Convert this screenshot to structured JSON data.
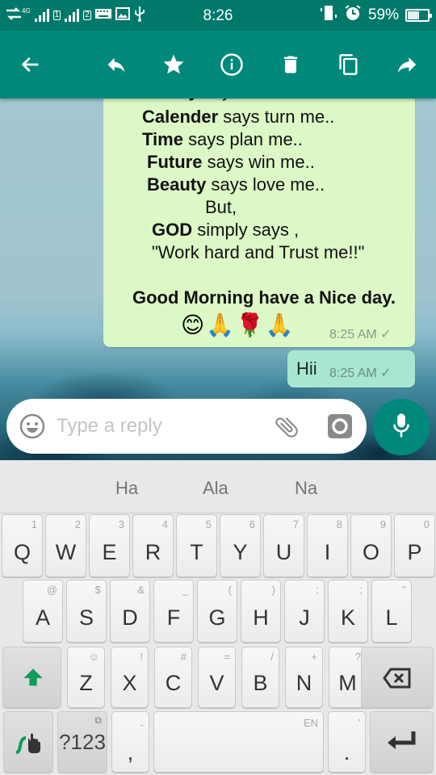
{
  "status_bar": {
    "time": "8:26",
    "network_type": "4G",
    "sim1_label": "1",
    "sim2_label": "2",
    "battery_percent_text": "59%",
    "battery_level": 0.59,
    "icons": [
      "data-transfer-icon",
      "signal-sim1-icon",
      "signal-sim2-icon",
      "keyboard-icon",
      "image-icon",
      "usb-icon",
      "vibrate-icon",
      "alarm-icon",
      "battery-icon"
    ]
  },
  "action_bar": {
    "icons": [
      "back-arrow-icon",
      "reply-icon",
      "star-icon",
      "info-icon",
      "delete-icon",
      "copy-icon",
      "forward-icon"
    ]
  },
  "messages": [
    {
      "type": "outgoing",
      "lines": [
        {
          "bold": "Money",
          "rest": " says earn me.."
        },
        {
          "bold": "Calender",
          "rest": " says turn me.."
        },
        {
          "bold": "Time",
          "rest": " says plan me.."
        },
        {
          "bold": "Future",
          "rest": " says win me.."
        },
        {
          "bold": "Beauty",
          "rest": " says love me.."
        },
        {
          "bold": "",
          "rest": "But,"
        },
        {
          "bold": "GOD",
          "rest": " simply says ,"
        },
        {
          "bold": "",
          "rest": "\"Work hard and Trust me!!\""
        },
        {
          "bold": "Good Morning have a Nice day.",
          "rest": ""
        }
      ],
      "emojis": "😊🙏🌹🙏",
      "time": "8:25 AM",
      "status": "✓"
    },
    {
      "type": "outgoing",
      "text": "Hii",
      "time": "8:25 AM",
      "status": "✓"
    }
  ],
  "composer": {
    "placeholder": "Type a reply",
    "value": ""
  },
  "keyboard": {
    "suggestions": [
      "Ha",
      "Ala",
      "Na"
    ],
    "row1": [
      {
        "k": "Q",
        "a": "1"
      },
      {
        "k": "W",
        "a": "2"
      },
      {
        "k": "E",
        "a": "3"
      },
      {
        "k": "R",
        "a": "4"
      },
      {
        "k": "T",
        "a": "5"
      },
      {
        "k": "Y",
        "a": "6"
      },
      {
        "k": "U",
        "a": "7"
      },
      {
        "k": "I",
        "a": "8"
      },
      {
        "k": "O",
        "a": "9"
      },
      {
        "k": "P",
        "a": "0"
      }
    ],
    "row2": [
      {
        "k": "A",
        "a": "@"
      },
      {
        "k": "S",
        "a": "$"
      },
      {
        "k": "D",
        "a": "&"
      },
      {
        "k": "F",
        "a": "_"
      },
      {
        "k": "G",
        "a": "("
      },
      {
        "k": "H",
        "a": ")"
      },
      {
        "k": "J",
        "a": ":"
      },
      {
        "k": "K",
        "a": ";"
      },
      {
        "k": "L",
        "a": "\""
      }
    ],
    "row3": [
      {
        "k": "Z",
        "a": "☺"
      },
      {
        "k": "X",
        "a": "!"
      },
      {
        "k": "C",
        "a": "#"
      },
      {
        "k": "V",
        "a": "="
      },
      {
        "k": "B",
        "a": "/"
      },
      {
        "k": "N",
        "a": "+"
      },
      {
        "k": "M",
        "a": "?"
      }
    ],
    "symbols_label": "?123",
    "comma": ",",
    "comma_alt": "-",
    "space_lang": "EN",
    "period": ".",
    "period_alt": "'"
  }
}
